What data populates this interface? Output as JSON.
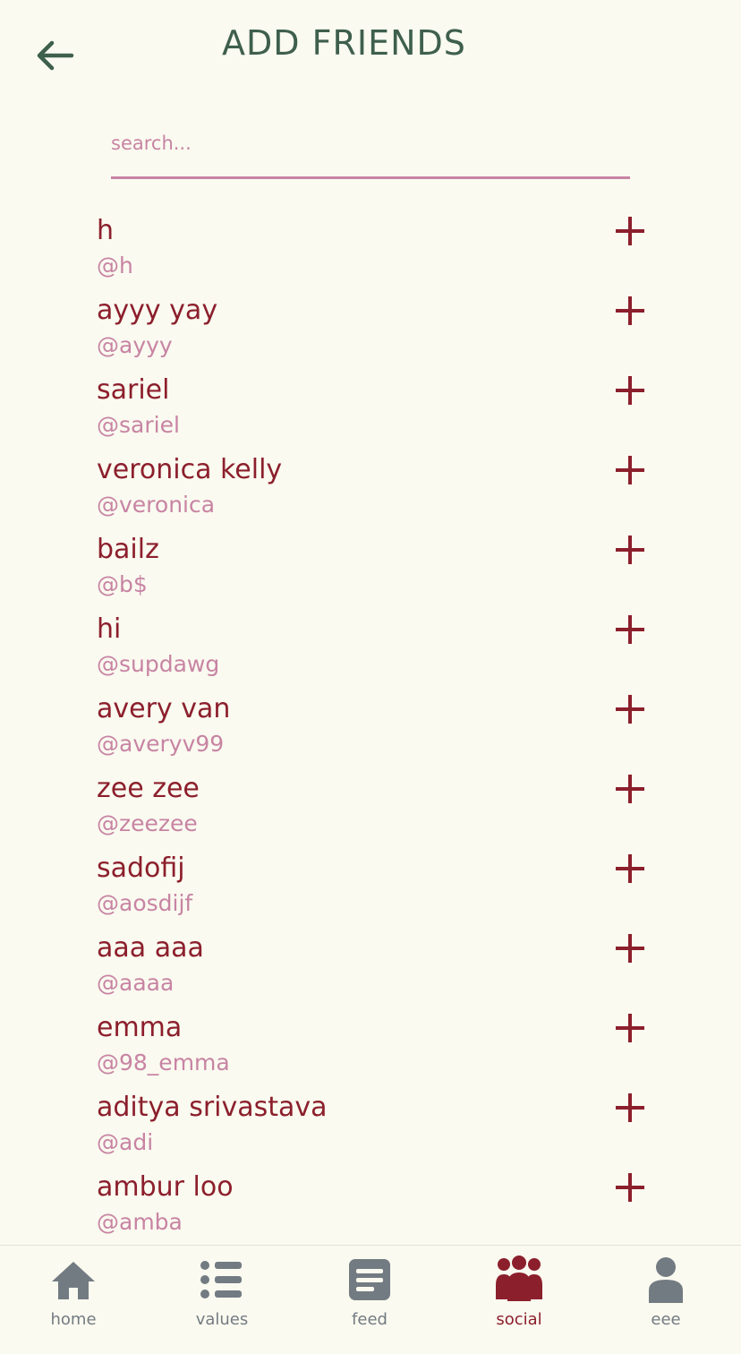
{
  "header": {
    "title": "ADD FRIENDS"
  },
  "search": {
    "placeholder": "search..."
  },
  "users": [
    {
      "name": "h",
      "handle": "@h"
    },
    {
      "name": "ayyy yay",
      "handle": "@ayyy"
    },
    {
      "name": "sariel",
      "handle": "@sariel"
    },
    {
      "name": "veronica kelly",
      "handle": "@veronica"
    },
    {
      "name": "bailz",
      "handle": "@b$"
    },
    {
      "name": "hi",
      "handle": "@supdawg"
    },
    {
      "name": "avery van",
      "handle": "@averyv99"
    },
    {
      "name": "zee zee",
      "handle": "@zeezee"
    },
    {
      "name": "sadofij",
      "handle": "@aosdijf"
    },
    {
      "name": "aaa aaa",
      "handle": "@aaaa"
    },
    {
      "name": "emma",
      "handle": "@98_emma"
    },
    {
      "name": "aditya srivastava",
      "handle": "@adi"
    },
    {
      "name": "ambur loo",
      "handle": "@amba"
    }
  ],
  "tabbar": {
    "items": [
      {
        "label": "home",
        "icon": "home-icon",
        "active": false
      },
      {
        "label": "values",
        "icon": "list-icon",
        "active": false
      },
      {
        "label": "feed",
        "icon": "feed-icon",
        "active": false
      },
      {
        "label": "social",
        "icon": "people-icon",
        "active": true
      },
      {
        "label": "eee",
        "icon": "person-icon",
        "active": false
      }
    ]
  },
  "colors": {
    "background": "#fafaf0",
    "title": "#3e5f4c",
    "name": "#8c1f2c",
    "handle": "#c884a3",
    "tab_inactive": "#737b82",
    "tab_active": "#8c1f2c"
  }
}
